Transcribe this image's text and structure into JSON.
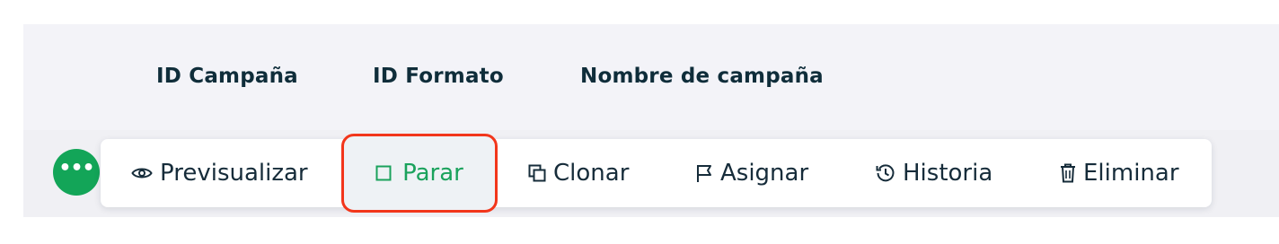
{
  "table": {
    "columns": [
      "ID Campaña",
      "ID Formato",
      "Nombre de campaña"
    ]
  },
  "row_menu": {
    "more_label": "•••",
    "actions": [
      {
        "label": "Previsualizar",
        "icon": "eye-icon"
      },
      {
        "label": "Parar",
        "icon": "square-icon",
        "highlighted": true
      },
      {
        "label": "Clonar",
        "icon": "copy-icon"
      },
      {
        "label": "Asignar",
        "icon": "flag-icon"
      },
      {
        "label": "Historia",
        "icon": "history-icon"
      },
      {
        "label": "Eliminar",
        "icon": "trash-icon"
      }
    ]
  },
  "colors": {
    "accent_green": "#13a558",
    "highlight_border": "#f2361b",
    "header_text": "#0f2d3a"
  }
}
